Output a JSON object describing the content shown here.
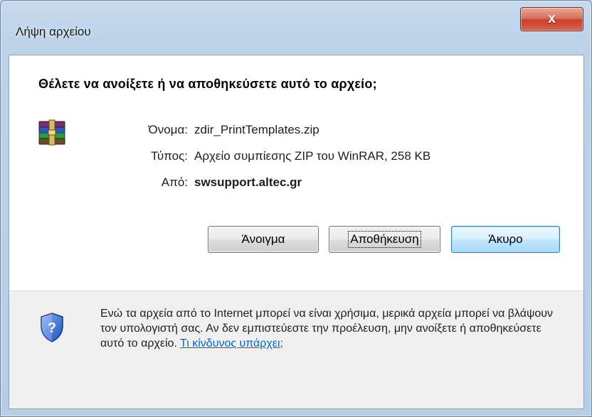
{
  "window": {
    "title": "Λήψη αρχείου",
    "close_label": "x"
  },
  "question": "Θέλετε να ανοίξετε ή να αποθηκεύσετε αυτό το αρχείο;",
  "file": {
    "icon": "winrar-archive-icon",
    "name_label": "Όνομα:",
    "name_value": "zdir_PrintTemplates.zip",
    "type_label": "Τύπος:",
    "type_value": "Αρχείο συμπίεσης ZIP του WinRAR, 258 KB",
    "from_label": "Από:",
    "from_value": "swsupport.altec.gr"
  },
  "buttons": {
    "open": "Άνοιγμα",
    "save": "Αποθήκευση",
    "cancel": "Άκυρο"
  },
  "warning": {
    "icon": "security-shield-icon",
    "text": "Ενώ τα αρχεία από το Internet μπορεί να είναι χρήσιμα, μερικά αρχεία μπορεί να βλάψουν τον υπολογιστή σας. Αν δεν εμπιστεύεστε την προέλευση, μην ανοίξετε ή αποθηκεύσετε αυτό το αρχείο.",
    "link": "Τι κίνδυνος υπάρχει;"
  },
  "colors": {
    "link": "#0066cc",
    "close_button": "#c7402a",
    "frame": "#b6cde6"
  }
}
